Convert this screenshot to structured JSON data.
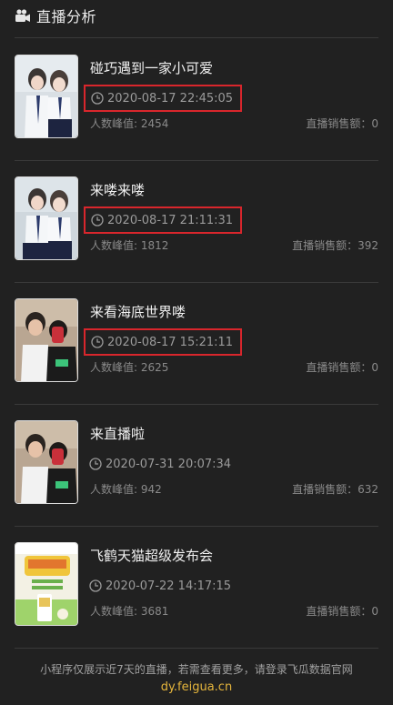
{
  "header": {
    "title": "直播分析",
    "icon": "video-camera-icon"
  },
  "items": [
    {
      "title": "碰巧遇到一家小可爱",
      "time": "2020-08-17 22:45:05",
      "highlighted": true,
      "peak": "人数峰值: 2454",
      "sales": "直播销售额：0"
    },
    {
      "title": "来喽来喽",
      "time": "2020-08-17 21:11:31",
      "highlighted": true,
      "peak": "人数峰值: 1812",
      "sales": "直播销售额：392"
    },
    {
      "title": "来看海底世界喽",
      "time": "2020-08-17 15:21:11",
      "highlighted": true,
      "peak": "人数峰值: 2625",
      "sales": "直播销售额：0"
    },
    {
      "title": "来直播啦",
      "time": "2020-07-31 20:07:34",
      "highlighted": false,
      "peak": "人数峰值: 942",
      "sales": "直播销售额：632"
    },
    {
      "title": "飞鹤天猫超级发布会",
      "time": "2020-07-22 14:17:15",
      "highlighted": false,
      "peak": "人数峰值: 3681",
      "sales": "直播销售额：0"
    }
  ],
  "footer": {
    "note": "小程序仅展示近7天的直播，若需查看更多，请登录飞瓜数据官网",
    "link": "dy.feigua.cn"
  },
  "colors": {
    "background": "#212121",
    "highlight": "#d9262c",
    "link": "#e5b53c"
  }
}
